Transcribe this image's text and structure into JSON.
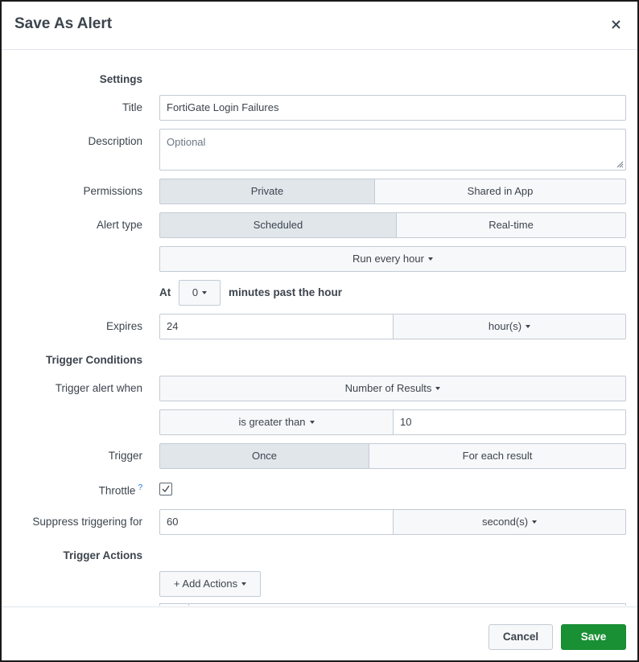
{
  "dialog": {
    "title": "Save As Alert"
  },
  "settings": {
    "section_label": "Settings",
    "title_label": "Title",
    "title_value": "FortiGate Login Failures",
    "description_label": "Description",
    "description_placeholder": "Optional",
    "permissions_label": "Permissions",
    "permissions_options": [
      "Private",
      "Shared in App"
    ],
    "permissions_selected": "Private",
    "alert_type_label": "Alert type",
    "alert_type_options": [
      "Scheduled",
      "Real-time"
    ],
    "alert_type_selected": "Scheduled",
    "schedule_dropdown": "Run every hour",
    "at_label": "At",
    "minutes_value": "0",
    "minutes_suffix": "minutes past the hour",
    "expires_label": "Expires",
    "expires_value": "24",
    "expires_unit": "hour(s)"
  },
  "trigger_conditions": {
    "section_label": "Trigger Conditions",
    "trigger_when_label": "Trigger alert when",
    "trigger_when_value": "Number of Results",
    "comparison_value": "is greater than",
    "threshold_value": "10",
    "trigger_label": "Trigger",
    "trigger_options": [
      "Once",
      "For each result"
    ],
    "trigger_selected": "Once",
    "throttle_label": "Throttle",
    "throttle_help": "?",
    "throttle_checked": true,
    "suppress_label": "Suppress triggering for",
    "suppress_value": "60",
    "suppress_unit": "second(s)"
  },
  "trigger_actions": {
    "section_label": "Trigger Actions",
    "add_actions_label": "+ Add Actions"
  },
  "footer": {
    "cancel_label": "Cancel",
    "save_label": "Save"
  },
  "colors": {
    "primary_button": "#1a9035",
    "active_toggle": "#e1e6eb",
    "border": "#c3cbd4",
    "help_link": "#1a73d9"
  }
}
